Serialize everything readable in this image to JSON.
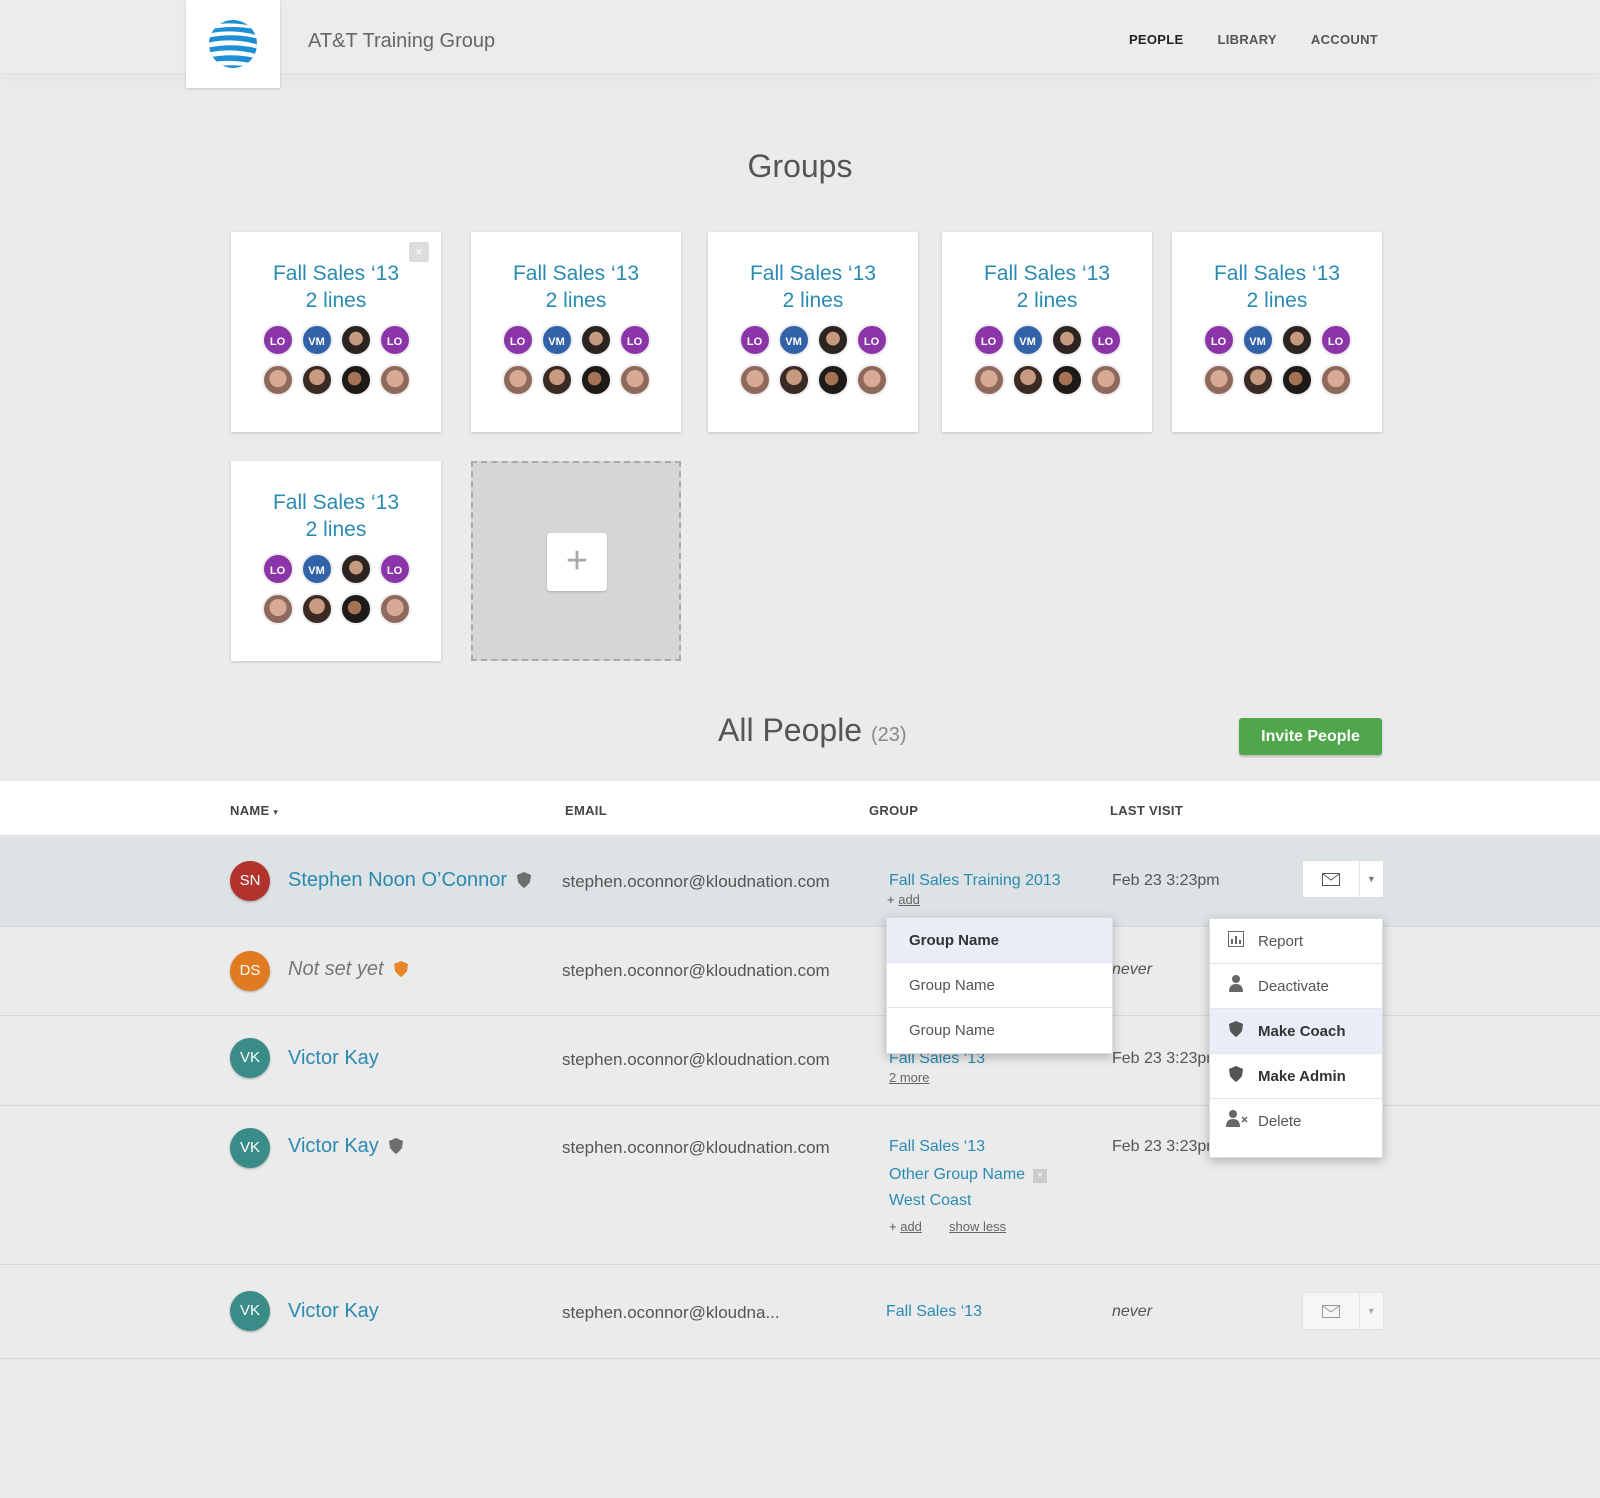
{
  "header": {
    "brand": "AT&T Training Group",
    "nav": [
      "PEOPLE",
      "LIBRARY",
      "ACCOUNT"
    ],
    "active_nav": "PEOPLE"
  },
  "groups": {
    "title": "Groups",
    "close_label": "×",
    "add_label": "+",
    "cards": [
      {
        "line1": "Fall Sales ‘13",
        "line2": "2 lines",
        "row1": [
          "LO",
          "VM",
          "",
          "LO"
        ]
      },
      {
        "line1": "Fall Sales ‘13",
        "line2": "2 lines",
        "row1": [
          "LO",
          "VM",
          "",
          "LO"
        ]
      },
      {
        "line1": "Fall Sales ‘13",
        "line2": "2 lines",
        "row1": [
          "LO",
          "VM",
          "",
          "LO"
        ]
      },
      {
        "line1": "Fall Sales ‘13",
        "line2": "2 lines",
        "row1": [
          "LO",
          "VM",
          "",
          "LO"
        ]
      },
      {
        "line1": "Fall Sales ‘13",
        "line2": "2 lines",
        "row1": [
          "LO",
          "VM",
          "",
          "LO"
        ]
      },
      {
        "line1": "Fall Sales ‘13",
        "line2": "2 lines",
        "row1": [
          "LO",
          "VM",
          "",
          "LO"
        ]
      }
    ]
  },
  "people": {
    "title": "All People",
    "count": "(23)",
    "invite_label": "Invite People",
    "columns": {
      "name": "NAME",
      "email": "EMAIL",
      "group": "GROUP",
      "last_visit": "LAST VISIT"
    },
    "sort_indicator": "▾",
    "rows": [
      {
        "initials": "SN",
        "name": "Stephen Noon O’Connor",
        "email": "stephen.oconnor@kloudnation.com",
        "group": "Fall Sales Training 2013",
        "add": "add",
        "last_visit": "Feb 23  3:23pm"
      },
      {
        "initials": "DS",
        "name": "Not set yet",
        "email": "stephen.oconnor@kloudnation.com",
        "last_visit": "never"
      },
      {
        "initials": "VK",
        "name": "Victor Kay",
        "email": "stephen.oconnor@kloudnation.com",
        "group": "Fall Sales ‘13",
        "more": "2 more",
        "last_visit": "Feb 23  3:23pm"
      },
      {
        "initials": "VK",
        "name": "Victor Kay",
        "email": "stephen.oconnor@kloudnation.com",
        "groups": [
          "Fall Sales ‘13",
          "Other Group Name",
          "West Coast"
        ],
        "add": "add",
        "show_less": "show less",
        "last_visit": "Feb 23  3:23pm"
      },
      {
        "initials": "VK",
        "name": "Victor Kay",
        "email": "stephen.oconnor@kloudna...",
        "group": "Fall Sales ‘13",
        "last_visit": "never"
      }
    ]
  },
  "group_dropdown": {
    "items": [
      "Group Name",
      "Group Name",
      "Group Name"
    ]
  },
  "actions_menu": {
    "items": [
      "Report",
      "Deactivate",
      "Make Coach",
      "Make Admin",
      "Delete"
    ]
  },
  "colors": {
    "link": "#2a8ab2",
    "invite": "#4fa64b",
    "lo": "#8c35a8",
    "vm": "#3263a8"
  }
}
